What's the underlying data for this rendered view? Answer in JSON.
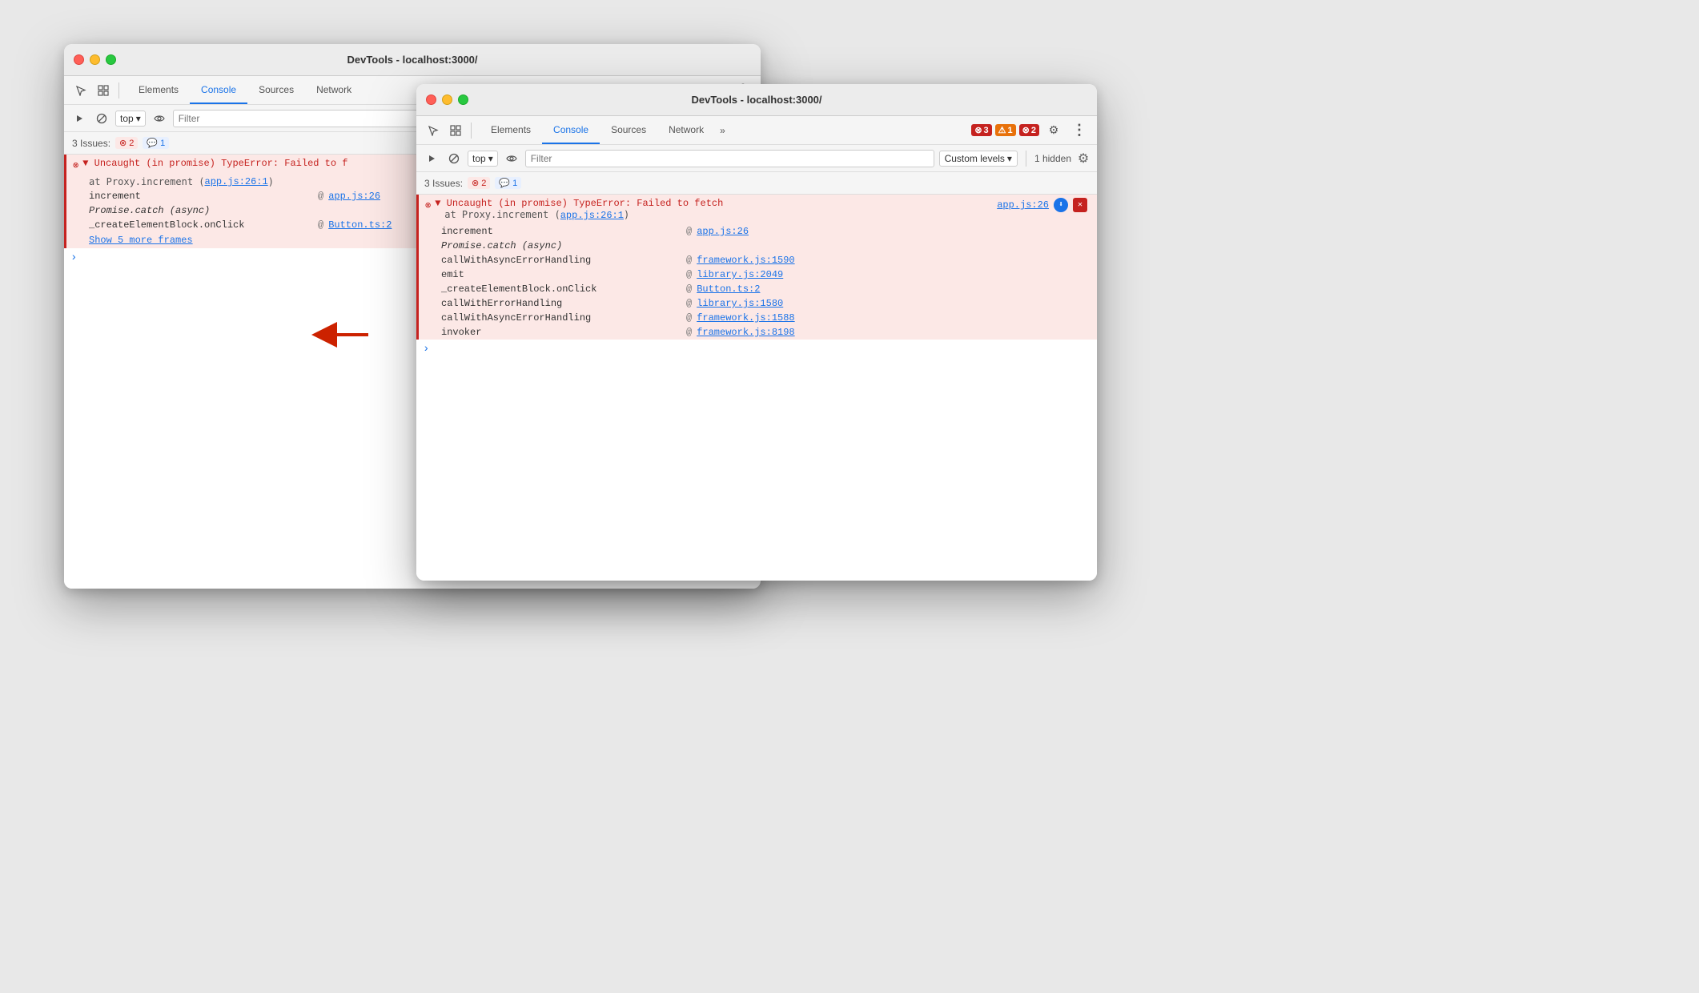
{
  "back_window": {
    "title": "DevTools - localhost:3000/",
    "tabs": [
      "Elements",
      "Console",
      "Sources",
      "Network"
    ],
    "active_tab": "Console",
    "toolbar": {
      "top_label": "top",
      "filter_placeholder": "Filter"
    },
    "issues": {
      "label": "3 Issues:",
      "error_count": "2",
      "info_count": "1"
    },
    "error": {
      "main": "▼ Uncaught (in promise) TypeError: Failed to f",
      "sub": "at Proxy.increment (app.js:26:1)",
      "link": "app.js:26"
    },
    "stack": [
      {
        "func": "increment",
        "at": "@",
        "link": "app.js:26"
      },
      {
        "func": "Promise.catch (async)",
        "at": "",
        "link": ""
      },
      {
        "func": "_createElementBlock.onClick",
        "at": "@",
        "link": "Button.ts:2"
      }
    ],
    "show_more": "Show 5 more frames"
  },
  "front_window": {
    "title": "DevTools - localhost:3000/",
    "tabs": [
      "Elements",
      "Console",
      "Sources",
      "Network"
    ],
    "active_tab": "Console",
    "toolbar": {
      "top_label": "top",
      "filter_placeholder": "Filter",
      "custom_levels": "Custom levels",
      "hidden": "1 hidden"
    },
    "badge_counts": {
      "error": "3",
      "warning": "1",
      "error2": "2"
    },
    "issues": {
      "label": "3 Issues:",
      "error_count": "2",
      "info_count": "1"
    },
    "error": {
      "main": "▼ Uncaught (in promise) TypeError: Failed to fetch",
      "sub": "at Proxy.increment (app.js:26:1)",
      "link_text": "app.js:26"
    },
    "stack": [
      {
        "func": "increment",
        "at": "@",
        "link": "app.js:26",
        "italic": false
      },
      {
        "func": "Promise.catch (async)",
        "at": "",
        "link": "",
        "italic": true
      },
      {
        "func": "callWithAsyncErrorHandling",
        "at": "@",
        "link": "framework.js:1590",
        "italic": false
      },
      {
        "func": "emit",
        "at": "@",
        "link": "library.js:2049",
        "italic": false
      },
      {
        "func": "_createElementBlock.onClick",
        "at": "@",
        "link": "Button.ts:2",
        "italic": false
      },
      {
        "func": "callWithErrorHandling",
        "at": "@",
        "link": "library.js:1580",
        "italic": false
      },
      {
        "func": "callWithAsyncErrorHandling",
        "at": "@",
        "link": "framework.js:1588",
        "italic": false
      },
      {
        "func": "invoker",
        "at": "@",
        "link": "framework.js:8198",
        "italic": false
      }
    ]
  },
  "icons": {
    "cursor": "⬆",
    "inspect": "◱",
    "play": "▶",
    "ban": "⊘",
    "eye": "👁",
    "chevron_down": "▾",
    "gear": "⚙",
    "more": "⋮",
    "download": "⬇",
    "close_x": "✕"
  }
}
